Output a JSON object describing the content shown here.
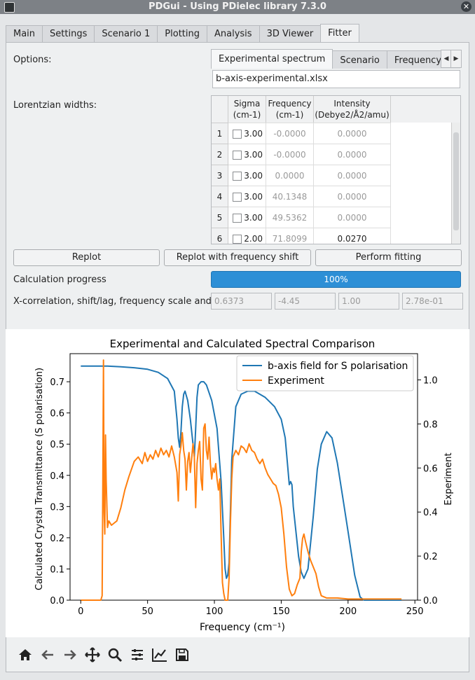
{
  "window": {
    "title": "PDGui - Using PDielec library 7.3.0"
  },
  "tabs": [
    "Main",
    "Settings",
    "Scenario 1",
    "Plotting",
    "Analysis",
    "3D Viewer",
    "Fitter"
  ],
  "active_tab": "Fitter",
  "fitter": {
    "options_label": "Options:",
    "subtabs": [
      "Experimental spectrum",
      "Scenario",
      "Frequency scali"
    ],
    "filename": "b-axis-experimental.xlsx",
    "widths_label": "Lorentzian widths:",
    "table": {
      "headers": [
        "Sigma\n(cm-1)",
        "Frequency\n(cm-1)",
        "Intensity\n(Debye2/Å2/amu)"
      ],
      "header_sigma": [
        "Sigma",
        "(cm-1)"
      ],
      "header_freq": [
        "Frequency",
        "(cm-1)"
      ],
      "header_int": [
        "Intensity",
        "(Debye2/Å2/amu)"
      ],
      "rows": [
        {
          "n": "1",
          "sigma": "3.00",
          "freq": "-0.0000",
          "intensity": "0.0000"
        },
        {
          "n": "2",
          "sigma": "3.00",
          "freq": "-0.0000",
          "intensity": "0.0000"
        },
        {
          "n": "3",
          "sigma": "3.00",
          "freq": "0.0000",
          "intensity": "0.0000"
        },
        {
          "n": "4",
          "sigma": "3.00",
          "freq": "40.1348",
          "intensity": "0.0000"
        },
        {
          "n": "5",
          "sigma": "3.00",
          "freq": "49.5362",
          "intensity": "0.0000"
        },
        {
          "n": "6",
          "sigma": "2.00",
          "freq": "71.8099",
          "intensity": "0.0270"
        }
      ]
    },
    "buttons": {
      "replot": "Replot",
      "replot_shift": "Replot with frequency shift",
      "fit": "Perform fitting"
    },
    "progress_label": "Calculation progress",
    "progress_text": "100%",
    "progress_value": 1.0,
    "xcorr_label": "X-correlation, shift/lag, frequency scale and rmse",
    "xcorr_values": [
      "0.6373",
      "-4.45",
      "1.00",
      "2.78e-01"
    ]
  },
  "chart_data": {
    "type": "line",
    "title": "Experimental and Calculated Spectral Comparison",
    "xlabel": "Frequency (cm⁻¹)",
    "ylabel": "Calculated Crystal Transmittance (S polarisation)",
    "y2label": "Experiment",
    "xlim": [
      -8,
      252
    ],
    "ylim": [
      0,
      0.79
    ],
    "y2lim": [
      0,
      1.119
    ],
    "xticks": [
      "0",
      "50",
      "100",
      "150",
      "200",
      "250"
    ],
    "yticks": [
      "0.0",
      "0.1",
      "0.2",
      "0.3",
      "0.4",
      "0.5",
      "0.6",
      "0.7"
    ],
    "y2ticks": [
      "0.0",
      "0.2",
      "0.4",
      "0.6",
      "0.8",
      "1.0"
    ],
    "legend_position": "top-right",
    "series": [
      {
        "name": "b-axis field for S polarisation",
        "color": "#1f77b4",
        "axis": "left",
        "points": [
          [
            0,
            0.75
          ],
          [
            20,
            0.75
          ],
          [
            30,
            0.748
          ],
          [
            40,
            0.745
          ],
          [
            50,
            0.74
          ],
          [
            58,
            0.73
          ],
          [
            65,
            0.71
          ],
          [
            70,
            0.67
          ],
          [
            72,
            0.58
          ],
          [
            73,
            0.52
          ],
          [
            74,
            0.49
          ],
          [
            75,
            0.54
          ],
          [
            76,
            0.62
          ],
          [
            77,
            0.66
          ],
          [
            78,
            0.67
          ],
          [
            80,
            0.64
          ],
          [
            82,
            0.58
          ],
          [
            84,
            0.5
          ],
          [
            85,
            0.46
          ],
          [
            86,
            0.55
          ],
          [
            87,
            0.65
          ],
          [
            88,
            0.69
          ],
          [
            90,
            0.7
          ],
          [
            92,
            0.7
          ],
          [
            94,
            0.69
          ],
          [
            98,
            0.64
          ],
          [
            102,
            0.55
          ],
          [
            105,
            0.38
          ],
          [
            107,
            0.2
          ],
          [
            108,
            0.1
          ],
          [
            109,
            0.07
          ],
          [
            110,
            0.08
          ],
          [
            111,
            0.12
          ],
          [
            113,
            0.45
          ],
          [
            116,
            0.62
          ],
          [
            120,
            0.66
          ],
          [
            125,
            0.67
          ],
          [
            130,
            0.67
          ],
          [
            138,
            0.65
          ],
          [
            145,
            0.62
          ],
          [
            150,
            0.58
          ],
          [
            153,
            0.52
          ],
          [
            155,
            0.42
          ],
          [
            156,
            0.37
          ],
          [
            157,
            0.38
          ],
          [
            158,
            0.37
          ],
          [
            159,
            0.3
          ],
          [
            161,
            0.22
          ],
          [
            163,
            0.14
          ],
          [
            165,
            0.09
          ],
          [
            167,
            0.07
          ],
          [
            170,
            0.1
          ],
          [
            174,
            0.27
          ],
          [
            177,
            0.42
          ],
          [
            180,
            0.5
          ],
          [
            184,
            0.54
          ],
          [
            188,
            0.52
          ],
          [
            192,
            0.44
          ],
          [
            196,
            0.33
          ],
          [
            200,
            0.22
          ],
          [
            205,
            0.08
          ],
          [
            209,
            0.01
          ],
          [
            212,
            0
          ],
          [
            240,
            0
          ]
        ]
      },
      {
        "name": "Experiment",
        "color": "#ff7f0e",
        "axis": "right",
        "points": [
          [
            0,
            0
          ],
          [
            15,
            0
          ],
          [
            16,
            0.02
          ],
          [
            16.5,
            0.5
          ],
          [
            17,
            1.09
          ],
          [
            17.5,
            0.4
          ],
          [
            18,
            0.3
          ],
          [
            18.5,
            0.75
          ],
          [
            19,
            0.55
          ],
          [
            20,
            0.33
          ],
          [
            21,
            0.36
          ],
          [
            23,
            0.34
          ],
          [
            25,
            0.35
          ],
          [
            27,
            0.36
          ],
          [
            30,
            0.42
          ],
          [
            33,
            0.5
          ],
          [
            36,
            0.56
          ],
          [
            40,
            0.63
          ],
          [
            43,
            0.65
          ],
          [
            46,
            0.62
          ],
          [
            48,
            0.67
          ],
          [
            50,
            0.63
          ],
          [
            52,
            0.66
          ],
          [
            54,
            0.64
          ],
          [
            56,
            0.68
          ],
          [
            58,
            0.65
          ],
          [
            60,
            0.69
          ],
          [
            62,
            0.66
          ],
          [
            64,
            0.68
          ],
          [
            66,
            0.65
          ],
          [
            68,
            0.7
          ],
          [
            70,
            0.65
          ],
          [
            72,
            0.58
          ],
          [
            73,
            0.45
          ],
          [
            74,
            0.66
          ],
          [
            75,
            0.7
          ],
          [
            76,
            0.76
          ],
          [
            77,
            0.68
          ],
          [
            78,
            0.64
          ],
          [
            79,
            0.5
          ],
          [
            80,
            0.63
          ],
          [
            81,
            0.67
          ],
          [
            82,
            0.58
          ],
          [
            84,
            0.71
          ],
          [
            85,
            0.65
          ],
          [
            86,
            0.42
          ],
          [
            87,
            0.62
          ],
          [
            88,
            0.68
          ],
          [
            89,
            0.72
          ],
          [
            90,
            0.55
          ],
          [
            91,
            0.5
          ],
          [
            92,
            0.78
          ],
          [
            93,
            0.8
          ],
          [
            94,
            0.68
          ],
          [
            95,
            0.64
          ],
          [
            96,
            0.74
          ],
          [
            97,
            0.62
          ],
          [
            98,
            0.55
          ],
          [
            99,
            0.6
          ],
          [
            100,
            0.58
          ],
          [
            101,
            0.62
          ],
          [
            102,
            0.55
          ],
          [
            103,
            0.5
          ],
          [
            104,
            0.55
          ],
          [
            105,
            0.3
          ],
          [
            106,
            0.08
          ],
          [
            107,
            0.03
          ],
          [
            108,
            0
          ],
          [
            110,
            0
          ],
          [
            111,
            0.1
          ],
          [
            112,
            0.35
          ],
          [
            113,
            0.55
          ],
          [
            114,
            0.65
          ],
          [
            116,
            0.68
          ],
          [
            118,
            0.66
          ],
          [
            120,
            0.7
          ],
          [
            122,
            0.69
          ],
          [
            124,
            0.67
          ],
          [
            126,
            0.71
          ],
          [
            128,
            0.68
          ],
          [
            130,
            0.67
          ],
          [
            132,
            0.64
          ],
          [
            134,
            0.62
          ],
          [
            136,
            0.64
          ],
          [
            138,
            0.6
          ],
          [
            140,
            0.57
          ],
          [
            142,
            0.55
          ],
          [
            144,
            0.53
          ],
          [
            146,
            0.52
          ],
          [
            148,
            0.48
          ],
          [
            150,
            0.42
          ],
          [
            152,
            0.3
          ],
          [
            154,
            0.15
          ],
          [
            156,
            0.05
          ],
          [
            158,
            0.02
          ],
          [
            160,
            0.03
          ],
          [
            162,
            0.07
          ],
          [
            164,
            0.1
          ],
          [
            165,
            0.22
          ],
          [
            166,
            0.28
          ],
          [
            167,
            0.3
          ],
          [
            168,
            0.27
          ],
          [
            170,
            0.22
          ],
          [
            172,
            0.18
          ],
          [
            174,
            0.15
          ],
          [
            176,
            0.12
          ],
          [
            178,
            0.06
          ],
          [
            180,
            0.02
          ],
          [
            184,
            0.01
          ],
          [
            188,
            0.01
          ],
          [
            192,
            0.01
          ],
          [
            200,
            0.005
          ],
          [
            210,
            0.005
          ],
          [
            220,
            0.005
          ],
          [
            230,
            0.005
          ],
          [
            240,
            0.005
          ]
        ]
      }
    ]
  },
  "toolbar_icons": [
    "home-icon",
    "back-icon",
    "forward-icon",
    "pan-icon",
    "zoom-icon",
    "subplots-icon",
    "customize-icon",
    "save-icon"
  ]
}
